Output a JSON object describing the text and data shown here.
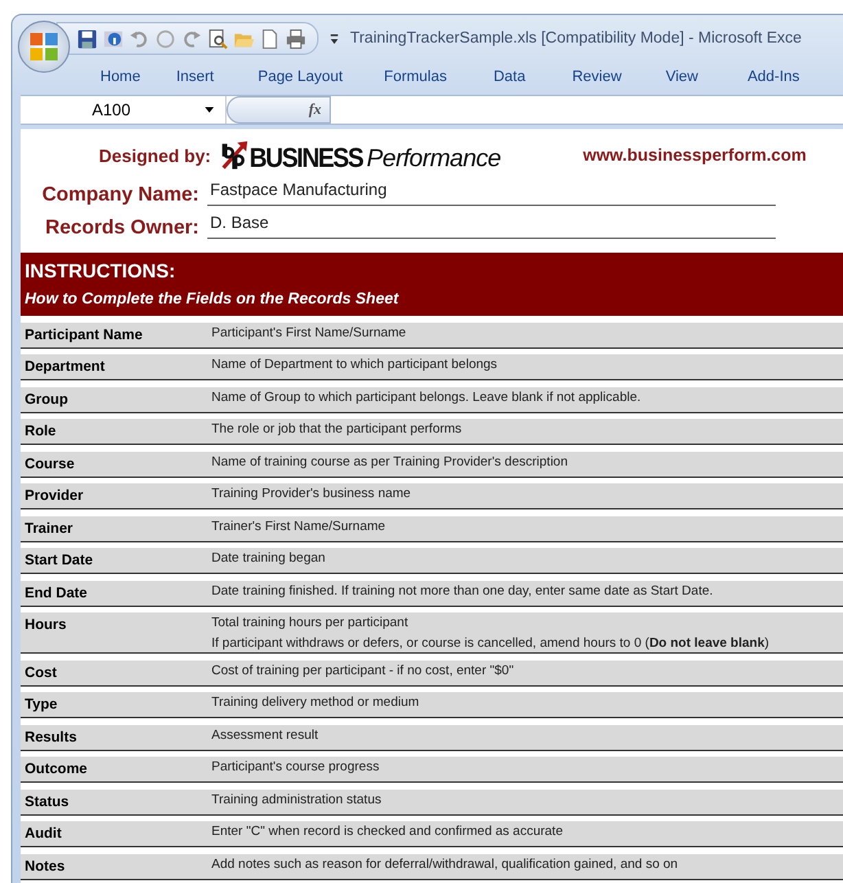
{
  "window": {
    "title": "TrainingTrackerSample.xls  [Compatibility Mode] - Microsoft Exce"
  },
  "ribbon_tabs": [
    {
      "label": "Home",
      "selected": false
    },
    {
      "label": "Insert",
      "selected": false
    },
    {
      "label": "Page Layout",
      "selected": false
    },
    {
      "label": "Formulas",
      "selected": false
    },
    {
      "label": "Data",
      "selected": false
    },
    {
      "label": "Review",
      "selected": false
    },
    {
      "label": "View",
      "selected": false
    },
    {
      "label": "Add-Ins",
      "selected": false
    }
  ],
  "formula_bar": {
    "name_box": "A100",
    "formula_symbol": "fx"
  },
  "sheet": {
    "designed_by_label": "Designed by:",
    "logo_words": [
      "BUSINESS",
      "Performance"
    ],
    "website": "www.businessperform.com",
    "fields": [
      {
        "label": "Company Name:",
        "value": "Fastpace Manufacturing"
      },
      {
        "label": "Records Owner:",
        "value": "D. Base"
      }
    ],
    "instructions_title": "INSTRUCTIONS:",
    "instructions_subtitle": "How to Complete the Fields on the Records Sheet",
    "rows": [
      {
        "field": "Participant Name",
        "lines": [
          "Participant's First Name/Surname"
        ]
      },
      {
        "field": "Department",
        "lines": [
          "Name of Department to which participant belongs"
        ]
      },
      {
        "field": "Group",
        "lines": [
          "Name of Group to which participant belongs. Leave blank if not applicable."
        ]
      },
      {
        "field": "Role",
        "lines": [
          "The role or job that the participant performs"
        ]
      },
      {
        "field": "Course",
        "lines": [
          "Name of training course as per Training Provider's description"
        ]
      },
      {
        "field": "Provider",
        "lines": [
          "Training Provider's business name"
        ]
      },
      {
        "field": "Trainer",
        "lines": [
          "Trainer's First Name/Surname"
        ]
      },
      {
        "field": "Start Date",
        "lines": [
          "Date training began"
        ]
      },
      {
        "field": "End Date",
        "lines": [
          "Date training finished.  If training not more than one day, enter same date as Start Date."
        ]
      },
      {
        "field": "Hours",
        "lines": [
          "Total training hours per participant",
          "If participant withdraws or defers, or course is cancelled, amend hours to 0 (**Do not leave blank**)"
        ]
      },
      {
        "field": "Cost",
        "lines": [
          "Cost of training per participant - if no cost, enter \"$0\""
        ]
      },
      {
        "field": "Type",
        "lines": [
          "Training delivery method or medium"
        ]
      },
      {
        "field": "Results",
        "lines": [
          "Assessment result"
        ]
      },
      {
        "field": "Outcome",
        "lines": [
          "Participant's course progress"
        ]
      },
      {
        "field": "Status",
        "lines": [
          "Training administration status"
        ]
      },
      {
        "field": "Audit",
        "lines": [
          "Enter \"C\" when record is checked and confirmed as accurate"
        ]
      },
      {
        "field": "Notes",
        "lines": [
          "Add notes such as reason for deferral/withdrawal, qualification gained, and so on"
        ]
      }
    ]
  }
}
